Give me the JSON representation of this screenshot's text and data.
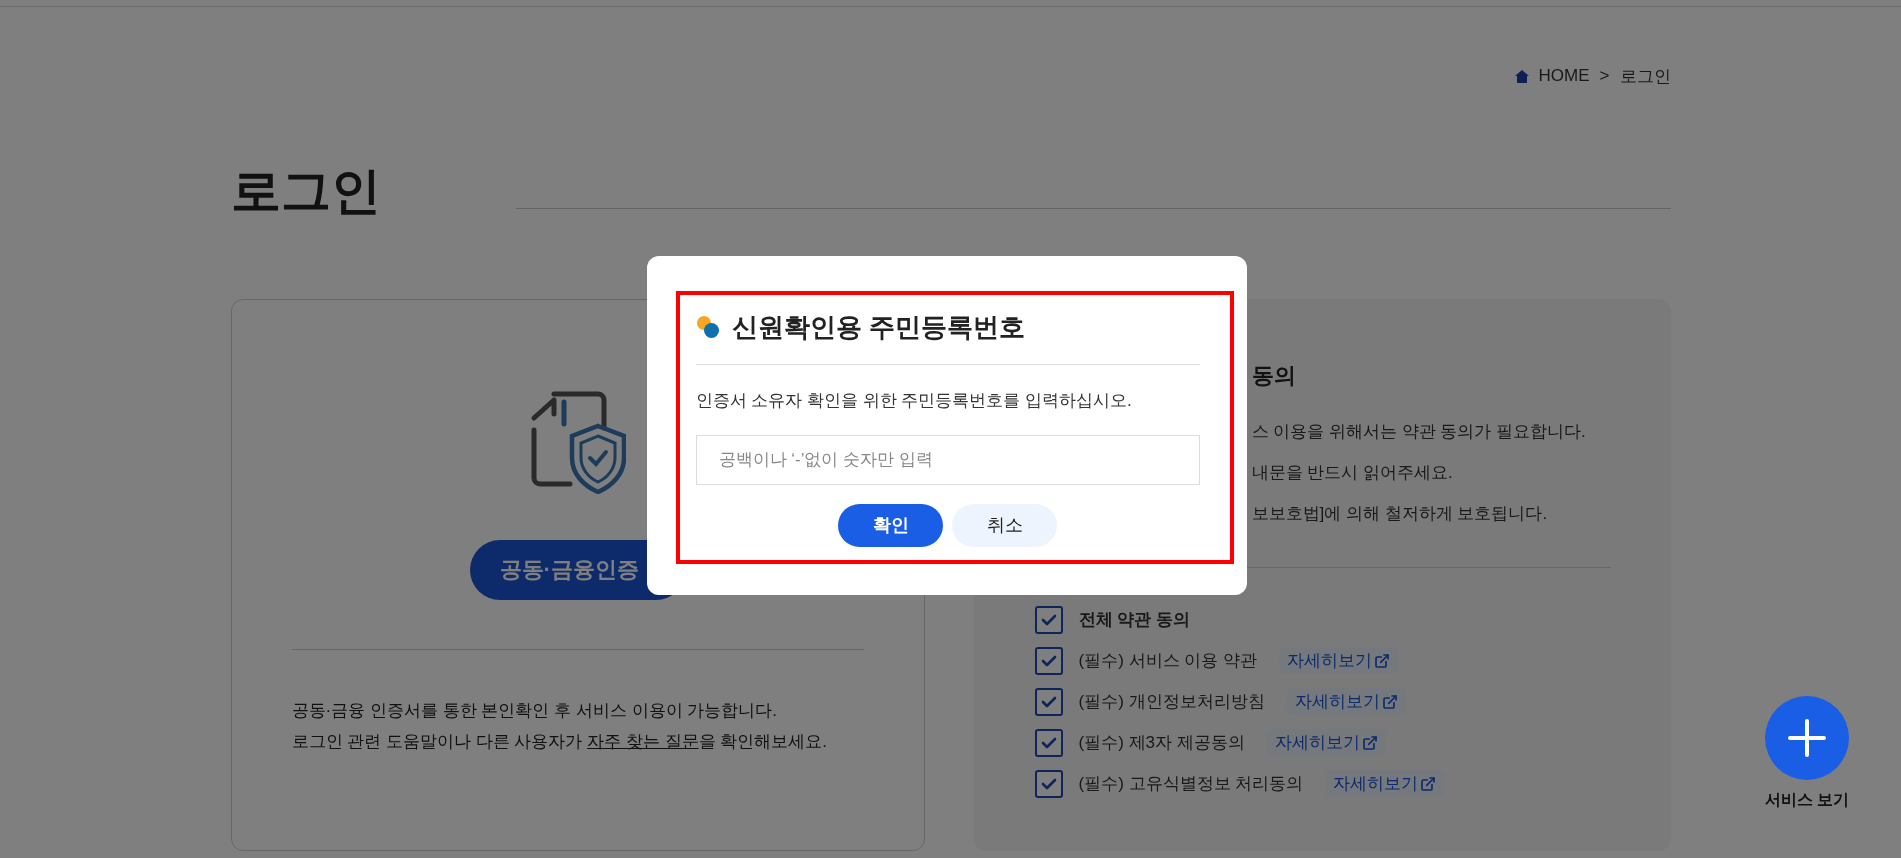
{
  "breadcrumb": {
    "items": [
      "HOME",
      "로그인"
    ],
    "separator": ">"
  },
  "page_title": "로그인",
  "certificate_card": {
    "button": "공동·금융인증",
    "lines": [
      {
        "before": "공동·금융 인증서를 통한 본인확인 후 서비스 이용이 가능합니다."
      },
      {
        "before": "로그인 관련 도움말이나 다른 사용자가 ",
        "link": "자주 찾는 질문",
        "after": "을 확인해보세요."
      }
    ]
  },
  "terms_card": {
    "title": "동의",
    "notes": [
      "스 이용을 위해서는 약관 동의가 필요합니다.",
      "내문을 반드시 읽어주세요.",
      "보보호법]에 의해 철저하게 보호됩니다."
    ],
    "items": [
      {
        "kind": "all",
        "label": "전체 약관 동의",
        "checked": true
      },
      {
        "kind": "required",
        "label": "(필수) 서비스 이용 약관",
        "checked": true,
        "link": "자세히보기"
      },
      {
        "kind": "required",
        "label": "(필수) 개인정보처리방침",
        "checked": true,
        "link": "자세히보기"
      },
      {
        "kind": "required",
        "label": "(필수) 제3자 제공동의",
        "checked": true,
        "link": "자세히보기"
      },
      {
        "kind": "required",
        "label": "(필수) 고유식별정보 처리동의",
        "checked": true,
        "link": "자세히보기"
      }
    ]
  },
  "modal": {
    "title": "신원확인용 주민등록번호",
    "description": "인증서 소유자 확인을 위한 주민등록번호를 입력하십시오.",
    "input": {
      "placeholder": "공백이나 ‘-’없이 숫자만 입력"
    },
    "highlighted": true,
    "buttons": [
      {
        "kind": "primary",
        "label": "확인"
      },
      {
        "kind": "secondary",
        "label": "취소"
      }
    ]
  },
  "fab": {
    "label": "서비스 보기"
  }
}
